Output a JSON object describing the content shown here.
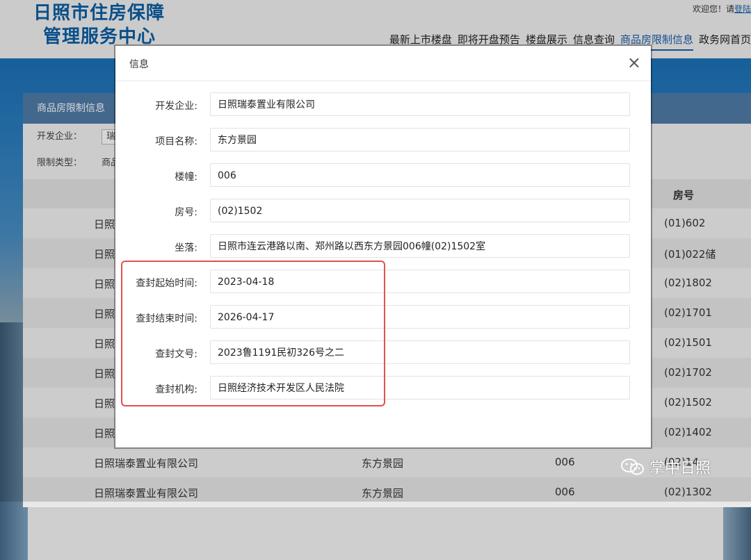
{
  "site": {
    "logo_line1": "日照市住房保障",
    "logo_line2": "管理服务中心",
    "welcome": "欢迎您！请",
    "login": "登陆"
  },
  "nav": [
    "最新上市楼盘",
    "即将开盘预告",
    "楼盘展示",
    "信息查询",
    "商品房限制信息",
    "政务网首页"
  ],
  "panel": {
    "title": "商品房限制信息",
    "filter_developer_label": "开发企业：",
    "filter_developer_value": "瑞泰",
    "filter_type_label": "限制类型：",
    "filter_type_value": "商品",
    "col_room": "房号"
  },
  "rows": [
    {
      "c1": "日照瑞",
      "c2": "",
      "c3": "",
      "c4": "(01)602"
    },
    {
      "c1": "日照瑞",
      "c2": "",
      "c3": "",
      "c4": "(01)022储"
    },
    {
      "c1": "日照瑞",
      "c2": "",
      "c3": "",
      "c4": "(02)1802"
    },
    {
      "c1": "日照瑞",
      "c2": "",
      "c3": "",
      "c4": "(02)1701"
    },
    {
      "c1": "日照瑞",
      "c2": "",
      "c3": "",
      "c4": "(02)1501"
    },
    {
      "c1": "日照瑞",
      "c2": "",
      "c3": "",
      "c4": "(02)1702"
    },
    {
      "c1": "日照瑞",
      "c2": "",
      "c3": "",
      "c4": "(02)1502"
    },
    {
      "c1": "日照瑞",
      "c2": "",
      "c3": "",
      "c4": "(02)1402"
    },
    {
      "c1": "日照瑞泰置业有限公司",
      "c2": "东方景园",
      "c3": "006",
      "c4": "(02)14"
    },
    {
      "c1": "日照瑞泰置业有限公司",
      "c2": "东方景园",
      "c3": "006",
      "c4": "(02)1302"
    }
  ],
  "modal": {
    "title": "信息",
    "close": "×",
    "fields": [
      {
        "label": "开发企业:",
        "value": "日照瑞泰置业有限公司"
      },
      {
        "label": "项目名称:",
        "value": "东方景园"
      },
      {
        "label": "楼幢:",
        "value": "006"
      },
      {
        "label": "房号:",
        "value": "(02)1502"
      },
      {
        "label": "坐落:",
        "value": "日照市连云港路以南、郑州路以西东方景园006幢(02)1502室"
      },
      {
        "label": "查封起始时间:",
        "value": "2023-04-18"
      },
      {
        "label": "查封结束时间:",
        "value": "2026-04-17"
      },
      {
        "label": "查封文号:",
        "value": "2023鲁1191民初326号之二"
      },
      {
        "label": "查封机构:",
        "value": "日照经济技术开发区人民法院"
      }
    ]
  },
  "watermark": {
    "text": "掌中日照",
    "icon": "wechat-icon"
  },
  "colors": {
    "highlight": "#e2504a",
    "brand": "#0b5fa5",
    "header": "#4f7ca8"
  }
}
